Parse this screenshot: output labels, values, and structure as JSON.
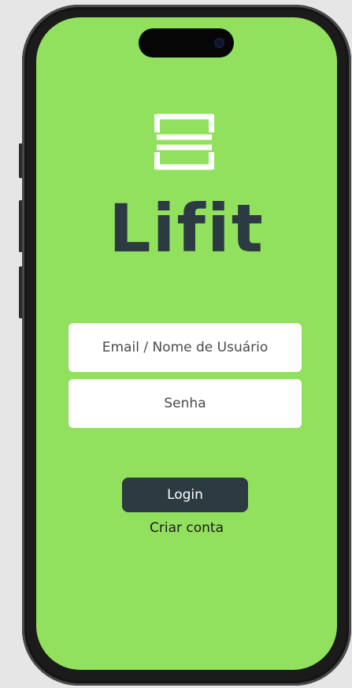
{
  "app": {
    "brand_name": "Lifit",
    "logo_icon": "app-logo-icon",
    "background_color": "#92e15e",
    "accent_color": "#2c3a41"
  },
  "login_form": {
    "email_placeholder": "Email / Nome de Usuário",
    "email_value": "",
    "password_placeholder": "Senha",
    "password_value": "",
    "login_label": "Login",
    "create_account_label": "Criar conta"
  }
}
